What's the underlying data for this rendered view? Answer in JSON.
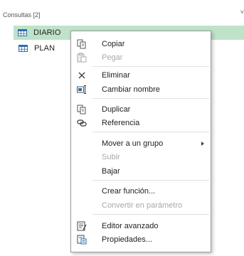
{
  "panel": {
    "header": "Consultas [2]",
    "queries": [
      {
        "label": "DIARIO",
        "selected": true,
        "icon": "table-icon"
      },
      {
        "label": "PLAN",
        "selected": false,
        "icon": "table-icon"
      }
    ]
  },
  "context_menu": {
    "items": {
      "copy": {
        "label": "Copiar",
        "icon": "copy-icon",
        "enabled": true
      },
      "paste": {
        "label": "Pegar",
        "icon": "paste-icon",
        "enabled": false
      },
      "delete": {
        "label": "Eliminar",
        "icon": "delete-icon",
        "enabled": true
      },
      "rename": {
        "label": "Cambiar nombre",
        "icon": "rename-icon",
        "enabled": true
      },
      "duplicate": {
        "label": "Duplicar",
        "icon": "duplicate-icon",
        "enabled": true
      },
      "reference": {
        "label": "Referencia",
        "icon": "reference-icon",
        "enabled": true
      },
      "move_to_group": {
        "label": "Mover a un grupo",
        "enabled": true,
        "submenu": true
      },
      "move_up": {
        "label": "Subir",
        "enabled": false
      },
      "move_down": {
        "label": "Bajar",
        "enabled": true
      },
      "create_function": {
        "label": "Crear función...",
        "enabled": true
      },
      "convert_parameter": {
        "label": "Convertir en parámetro",
        "enabled": false
      },
      "advanced_editor": {
        "label": "Editor avanzado",
        "icon": "advanced-editor-icon",
        "enabled": true
      },
      "properties": {
        "label": "Propiedades...",
        "icon": "properties-icon",
        "enabled": true
      }
    }
  },
  "colors": {
    "selected_row": "#bfe3c9",
    "table_icon": "#2e6fa8",
    "disabled_text": "#a8a8a8"
  }
}
